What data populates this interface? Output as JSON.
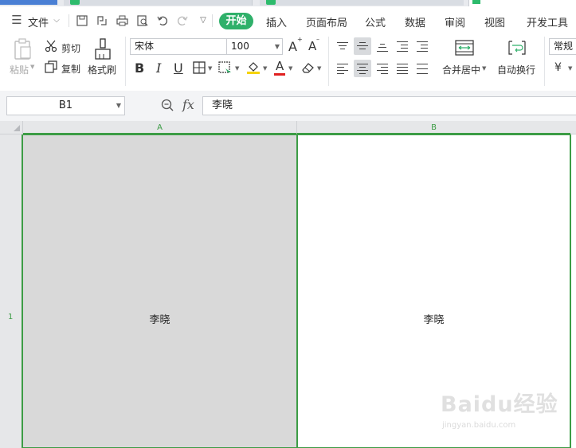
{
  "menu": {
    "file_label": "文件",
    "tabs": [
      "开始",
      "插入",
      "页面布局",
      "公式",
      "数据",
      "审阅",
      "视图",
      "开发工具"
    ],
    "active_tab": "开始"
  },
  "ribbon": {
    "paste_label": "粘贴",
    "cut_label": "剪切",
    "copy_label": "复制",
    "format_painter_label": "格式刷",
    "font_name": "宋体",
    "font_size": "100",
    "increase_font_label": "A",
    "decrease_font_label": "A",
    "bold_label": "B",
    "italic_label": "I",
    "underline_label": "U",
    "font_color_label": "A",
    "merge_center_label": "合并居中",
    "wrap_text_label": "自动换行",
    "number_format": "常规",
    "currency_symbol": "¥"
  },
  "formula_bar": {
    "name_box": "B1",
    "fx_label": "fx",
    "content": "李晓"
  },
  "sheet": {
    "columns": [
      "A",
      "B"
    ],
    "rows": [
      "1"
    ],
    "cells": {
      "A1": "李晓",
      "B1": "李晓"
    }
  },
  "watermark": {
    "brand": "Baidu经验",
    "url": "jingyan.baidu.com"
  },
  "colors": {
    "accent_green": "#2fb06a",
    "selection_green": "#3c9c45",
    "cell_a1_fill": "#d9d9d9"
  }
}
